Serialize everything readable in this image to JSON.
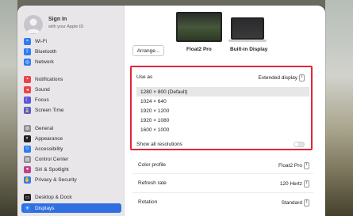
{
  "sidebar": {
    "account": {
      "title": "Sign In",
      "subtitle": "with your Apple ID"
    },
    "items": [
      {
        "label": "Wi-Fi",
        "icon": "wifi-icon",
        "color": "#2f7cf0"
      },
      {
        "label": "Bluetooth",
        "icon": "bluetooth-icon",
        "color": "#2f7cf0"
      },
      {
        "label": "Network",
        "icon": "network-icon",
        "color": "#2f7cf0"
      },
      {
        "label": "Notifications",
        "icon": "bell-icon",
        "color": "#ec4446"
      },
      {
        "label": "Sound",
        "icon": "speaker-icon",
        "color": "#ec4446"
      },
      {
        "label": "Focus",
        "icon": "moon-icon",
        "color": "#5a57d6"
      },
      {
        "label": "Screen Time",
        "icon": "hourglass-icon",
        "color": "#5a57d6"
      },
      {
        "label": "General",
        "icon": "gear-icon",
        "color": "#8e8e93"
      },
      {
        "label": "Appearance",
        "icon": "appearance-icon",
        "color": "#222222"
      },
      {
        "label": "Accessibility",
        "icon": "accessibility-icon",
        "color": "#2f7cf0"
      },
      {
        "label": "Control Center",
        "icon": "control-center-icon",
        "color": "#8e8e93"
      },
      {
        "label": "Siri & Spotlight",
        "icon": "siri-icon",
        "color": "#c2418d"
      },
      {
        "label": "Privacy & Security",
        "icon": "hand-icon",
        "color": "#2f7cf0"
      },
      {
        "label": "Desktop & Dock",
        "icon": "dock-icon",
        "color": "#222222"
      },
      {
        "label": "Displays",
        "icon": "sun-icon",
        "color": "#2f7cf0"
      }
    ],
    "selected_index": 14
  },
  "displays": {
    "arrange_label": "Arrange...",
    "primary_label": "Float2 Pro",
    "secondary_label": "Built-in Display"
  },
  "use_as": {
    "label": "Use as",
    "value": "Extended display"
  },
  "resolutions": [
    "1280 × 800 (Default)",
    "1024 × 640",
    "1920 × 1200",
    "1920 × 1080",
    "1600 × 1000"
  ],
  "selected_resolution_index": 0,
  "show_all": {
    "label": "Show all resolutions",
    "on": false
  },
  "settings": [
    {
      "label": "Color profile",
      "value": "Float2 Pro"
    },
    {
      "label": "Refresh rate",
      "value": "120 Hertz"
    },
    {
      "label": "Rotation",
      "value": "Standard"
    }
  ],
  "colors": {
    "accent": "#2f6fe0",
    "highlight_border": "#e0263a"
  }
}
